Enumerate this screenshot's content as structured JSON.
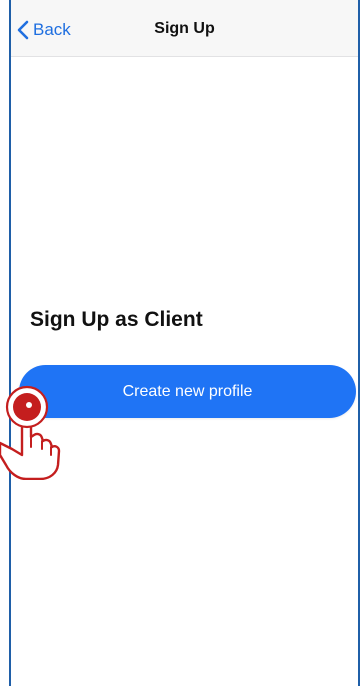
{
  "nav": {
    "back_label": "Back",
    "title": "Sign Up"
  },
  "main": {
    "heading": "Sign Up as Client",
    "create_profile_label": "Create new profile"
  },
  "colors": {
    "accent": "#1f74f5",
    "link": "#1f6fe0",
    "nav_background": "#f7f7f7",
    "cursor_red": "#c41e1e"
  },
  "icons": {
    "back": "chevron-left-icon",
    "cursor": "tap-hand-icon"
  }
}
